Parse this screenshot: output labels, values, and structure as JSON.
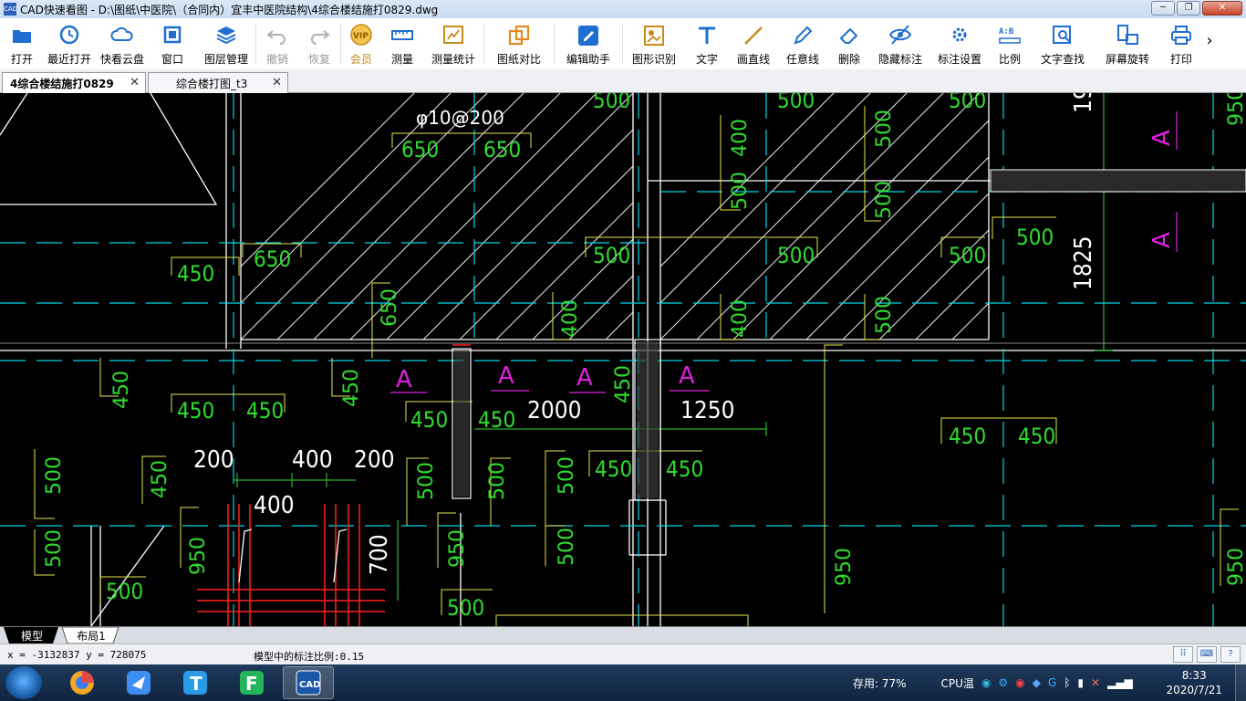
{
  "window": {
    "icon_text": "CAD",
    "title": "CAD快速看图 - D:\\图纸\\中医院\\（合同内）宜丰中医院结构\\4综合楼结施打0829.dwg",
    "buttons": {
      "minimize": "─",
      "restore": "❐",
      "close": "✕"
    }
  },
  "toolbar": {
    "items": [
      {
        "label": "打开",
        "icon": "folder-open-icon",
        "color": "#1f6fd0"
      },
      {
        "label": "最近打开",
        "icon": "clock-icon",
        "color": "#1f6fd0"
      },
      {
        "label": "快看云盘",
        "icon": "cloud-icon",
        "color": "#1f6fd0"
      },
      {
        "label": "窗口",
        "icon": "window-icon",
        "color": "#1f6fd0"
      },
      {
        "label": "图层管理",
        "icon": "layers-icon",
        "color": "#1f6fd0"
      },
      {
        "label": "撤销",
        "icon": "undo-icon",
        "color": "#b0b0b0"
      },
      {
        "label": "恢复",
        "icon": "redo-icon",
        "color": "#b0b0b0"
      },
      {
        "label": "会员",
        "icon": "vip-icon",
        "color": "#c8891a"
      },
      {
        "label": "测量",
        "icon": "ruler-icon",
        "color": "#1f6fd0"
      },
      {
        "label": "测量统计",
        "icon": "measure-stats-icon",
        "color": "#c8891a"
      },
      {
        "label": "图纸对比",
        "icon": "compare-icon",
        "color": "#e08b1a"
      },
      {
        "label": "编辑助手",
        "icon": "edit-assistant-icon",
        "color": "#1f6fd0"
      },
      {
        "label": "图形识别",
        "icon": "shape-recognize-icon",
        "color": "#c8891a"
      },
      {
        "label": "文字",
        "icon": "text-icon",
        "color": "#1f6fd0"
      },
      {
        "label": "画直线",
        "icon": "line-icon",
        "color": "#c8891a"
      },
      {
        "label": "任意线",
        "icon": "pen-icon",
        "color": "#1f6fd0"
      },
      {
        "label": "删除",
        "icon": "eraser-icon",
        "color": "#1f6fd0"
      },
      {
        "label": "隐藏标注",
        "icon": "eye-hide-icon",
        "color": "#1f6fd0"
      },
      {
        "label": "标注设置",
        "icon": "annotation-settings-icon",
        "color": "#1f6fd0"
      },
      {
        "label": "比例",
        "icon": "scale-icon",
        "color": "#1f6fd0"
      },
      {
        "label": "文字查找",
        "icon": "text-search-icon",
        "color": "#1f6fd0"
      },
      {
        "label": "屏幕旋转",
        "icon": "rotate-screen-icon",
        "color": "#1f6fd0"
      },
      {
        "label": "打印",
        "icon": "printer-icon",
        "color": "#1f6fd0"
      }
    ],
    "more": "›"
  },
  "tabs": [
    {
      "label": "4综合楼结施打0829",
      "active": true
    },
    {
      "label": "综合楼打图_t3",
      "active": false
    }
  ],
  "drawing": {
    "rebar_label": "φ10@200",
    "dims_green": [
      "650",
      "650",
      "650",
      "450",
      "500",
      "500",
      "500",
      "500",
      "500",
      "400",
      "400",
      "500",
      "500",
      "400",
      "650",
      "500",
      "450",
      "450",
      "450",
      "450",
      "450",
      "450",
      "450",
      "450",
      "450",
      "450",
      "450",
      "450",
      "500",
      "500",
      "500",
      "500",
      "500",
      "500",
      "500",
      "950",
      "950",
      "500",
      "500"
    ],
    "dims_white": [
      "2000",
      "1250",
      "200",
      "400",
      "200",
      "400",
      "700",
      "1825",
      "19"
    ],
    "section_marks": [
      "A",
      "A",
      "A",
      "A",
      "A",
      "A"
    ]
  },
  "layout_tabs": [
    {
      "label": "模型",
      "active": true
    },
    {
      "label": "布局1",
      "active": false
    }
  ],
  "status": {
    "coords": "x = -3132837  y = 728075",
    "scale_text": "模型中的标注比例:0.15"
  },
  "taskbar": {
    "tray_mem": "存用: 77%",
    "tray_cpu": "CPU温",
    "time": "8:33",
    "date": "2020/7/21"
  }
}
